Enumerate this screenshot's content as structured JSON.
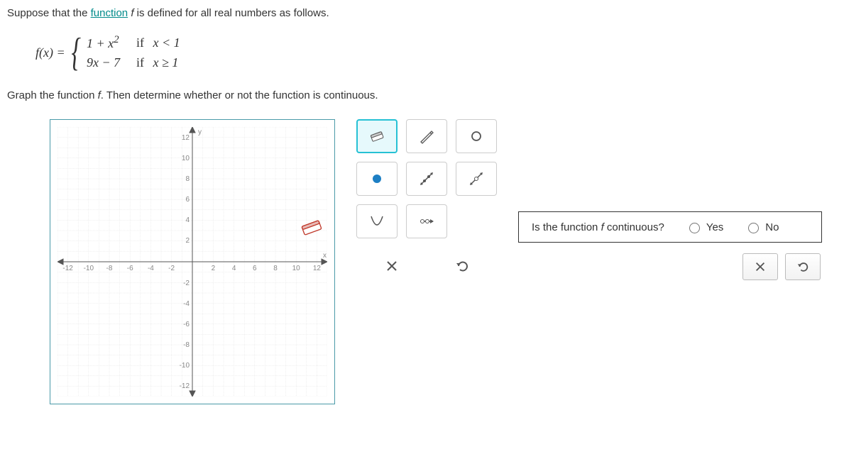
{
  "prompt": {
    "pre": "Suppose that the ",
    "link": "function",
    "post_link": " ",
    "fvar": "f",
    "post": " is defined for all real numbers as follows."
  },
  "function_def": {
    "lhs": "f(x) =",
    "case1_expr": "1 + x",
    "case1_sup": "2",
    "case1_if": "if",
    "case1_cond": "x < 1",
    "case2_expr": "9x − 7",
    "case2_if": "if",
    "case2_cond": "x ≥ 1"
  },
  "instruction": {
    "pre": "Graph the function ",
    "fvar": "f",
    "post": ". Then determine whether or not the function is continuous."
  },
  "chart_data": {
    "type": "cartesian-grid",
    "xlim": [
      -13,
      13
    ],
    "ylim": [
      -13,
      13
    ],
    "xticks": [
      -12,
      -10,
      -8,
      -6,
      -4,
      -2,
      2,
      4,
      6,
      8,
      10,
      12
    ],
    "yticks": [
      12,
      10,
      8,
      6,
      4,
      2,
      -2,
      -4,
      -6,
      -8,
      -10,
      -12
    ],
    "y_axis_label": "y",
    "x_axis_label": "x"
  },
  "tools": {
    "selected": "eraser",
    "names": [
      "eraser",
      "pencil",
      "open-circle",
      "closed-circle",
      "line-seg-closed",
      "line-seg-open",
      "parabola",
      "ray"
    ]
  },
  "question": {
    "text_pre": "Is the function ",
    "fvar": "f",
    "text_post": " continuous?",
    "yes": "Yes",
    "no": "No"
  }
}
